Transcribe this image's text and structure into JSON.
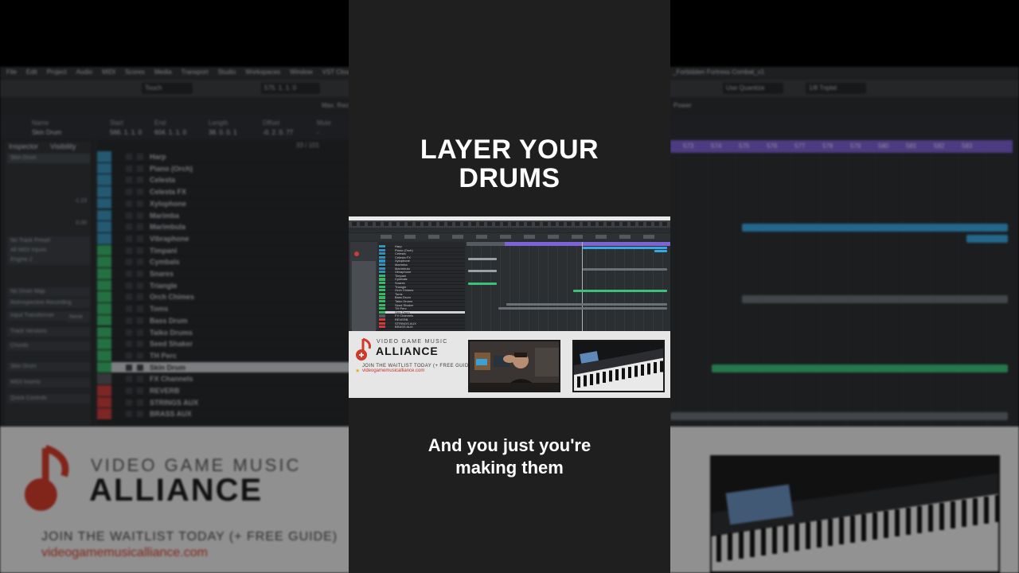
{
  "overlay": {
    "headline_line1": "LAYER YOUR",
    "headline_line2": "DRUMS",
    "caption_line1": "And you just you're",
    "caption_line2": "making them"
  },
  "daw": {
    "menu": [
      "File",
      "Edit",
      "Project",
      "Audio",
      "MIDI",
      "Scores",
      "Media",
      "Transport",
      "Studio",
      "Workspaces",
      "Window",
      "VST Cloud"
    ],
    "project_title": "_Forbidden Fortress Combat_v1",
    "toolbar": {
      "automation_mode": "Touch",
      "position": "575. 1. 1. 0",
      "quantize_mode": "Use Quantize",
      "quantize_value": "1/8 Triplet",
      "max_record": "Max. Reco",
      "power": "Power"
    },
    "info_line": {
      "headers": [
        "Name",
        "Start",
        "End",
        "Length",
        "Offset",
        "Mute"
      ],
      "values": [
        "Skin Drum",
        "566. 1. 1. 0",
        "604. 1. 1. 0",
        "38. 0. 0. 1",
        "-0. 2. 0. 77",
        "-"
      ]
    },
    "inspector": {
      "tab_inspector": "Inspector",
      "tab_visibility": "Visibility",
      "track_name": "Skin Drum",
      "rows": [
        "No Track Preset",
        "All MIDI Inputs",
        "Engine 2",
        "No Drum Map",
        "Retrospective Recording",
        "Input Transformer",
        "Track Versions",
        "Chords",
        "Skin Drum",
        "MIDI Inserts",
        "Quick Controls"
      ],
      "input_transformer_value": "None",
      "fader_value_1": "-1.23",
      "fader_value_2": "0.00",
      "counter": "33 / 101"
    },
    "tracks": [
      {
        "name": "Harp",
        "color": "#3a8fb7"
      },
      {
        "name": "Piano (Orch)",
        "color": "#3a8fb7"
      },
      {
        "name": "Celesta",
        "color": "#3a8fb7"
      },
      {
        "name": "Celesta FX",
        "color": "#3a8fb7"
      },
      {
        "name": "Xylophone",
        "color": "#3a8fb7"
      },
      {
        "name": "Marimba",
        "color": "#3a8fb7"
      },
      {
        "name": "Marimbula",
        "color": "#3a8fb7"
      },
      {
        "name": "Vibraphone",
        "color": "#3a8fb7"
      },
      {
        "name": "Timpani",
        "color": "#3bb56a"
      },
      {
        "name": "Cymbals",
        "color": "#3bb56a"
      },
      {
        "name": "Snares",
        "color": "#3bb56a"
      },
      {
        "name": "Triangle",
        "color": "#3bb56a"
      },
      {
        "name": "Orch Chimes",
        "color": "#3bb56a"
      },
      {
        "name": "Toms",
        "color": "#3bb56a"
      },
      {
        "name": "Bass Drum",
        "color": "#3bb56a"
      },
      {
        "name": "Taiko Drums",
        "color": "#3bb56a"
      },
      {
        "name": "Seed Shaker",
        "color": "#3bb56a"
      },
      {
        "name": "TH Perc",
        "color": "#3bb56a"
      },
      {
        "name": "Skin Drum",
        "color": "#3bb56a"
      },
      {
        "name": "FX Channels",
        "color": "#55595e"
      },
      {
        "name": "REVERB",
        "color": "#c93d3d"
      },
      {
        "name": "STRINGS AUX",
        "color": "#c93d3d"
      },
      {
        "name": "BRASS AUX",
        "color": "#c93d3d"
      }
    ],
    "ruler_bars": [
      "573",
      "574",
      "575",
      "576",
      "577",
      "578",
      "579",
      "580",
      "581",
      "582",
      "583"
    ]
  },
  "ad": {
    "brand_small": "VIDEO GAME MUSIC",
    "brand_big": "ALLIANCE",
    "cta": "JOIN THE WAITLIST TODAY (+ FREE GUIDE)",
    "url": "videogamemusicalliance.com"
  },
  "icons": [
    "music-note-logo-icon",
    "star-icon",
    "record-icon"
  ],
  "colors": {
    "background": "#000000",
    "center_panel": "#1f1f1f",
    "ruler_purple": "#7b5fd0",
    "clip_blue": "#39a7e0",
    "clip_green": "#3fc07a",
    "brand_red": "#d03a2a"
  }
}
